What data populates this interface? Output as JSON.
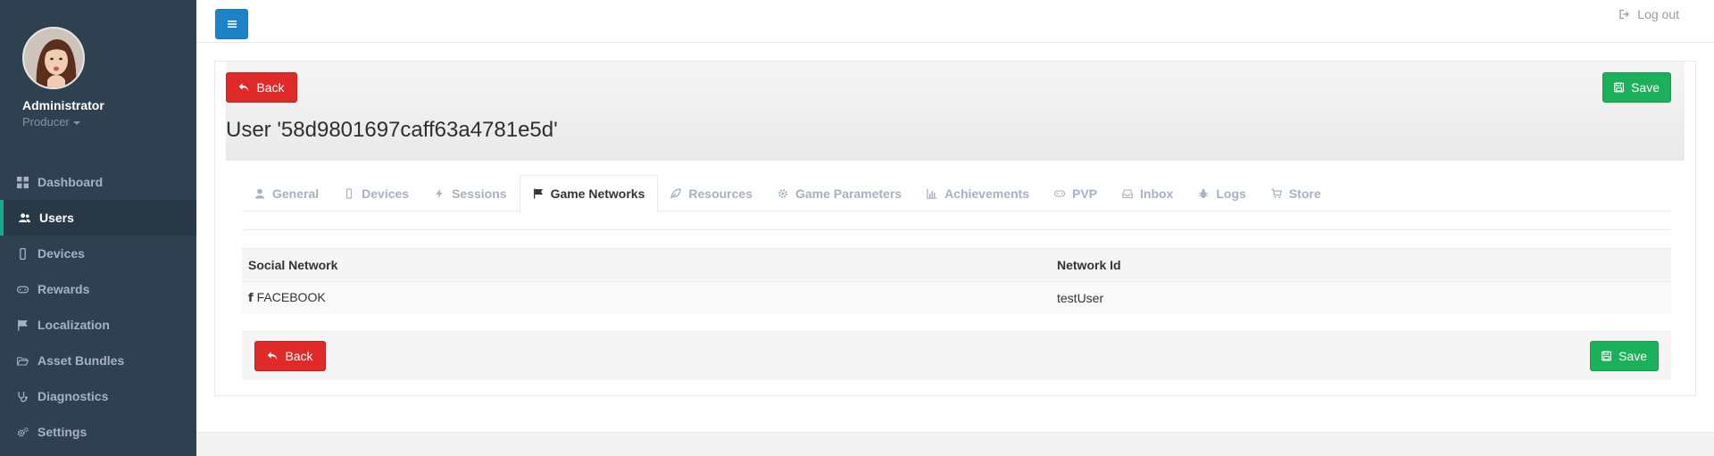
{
  "sidebar": {
    "profile": {
      "name": "Administrator",
      "role": "Producer"
    },
    "items": [
      {
        "label": "Dashboard",
        "icon": "dashboard-icon"
      },
      {
        "label": "Users",
        "icon": "users-icon",
        "active": true
      },
      {
        "label": "Devices",
        "icon": "mobile-icon"
      },
      {
        "label": "Rewards",
        "icon": "gamepad-icon"
      },
      {
        "label": "Localization",
        "icon": "flag-icon"
      },
      {
        "label": "Asset Bundles",
        "icon": "folder-open-icon"
      },
      {
        "label": "Diagnostics",
        "icon": "stethoscope-icon"
      },
      {
        "label": "Settings",
        "icon": "cogs-icon"
      }
    ]
  },
  "topbar": {
    "logout_label": "Log out"
  },
  "panel": {
    "title": "User '58d9801697caff63a4781e5d'",
    "back_label": "Back",
    "save_label": "Save"
  },
  "tabs": [
    {
      "label": "General",
      "icon": "user-icon"
    },
    {
      "label": "Devices",
      "icon": "mobile-icon"
    },
    {
      "label": "Sessions",
      "icon": "bolt-icon"
    },
    {
      "label": "Game Networks",
      "icon": "flag-icon",
      "active": true
    },
    {
      "label": "Resources",
      "icon": "leaf-icon"
    },
    {
      "label": "Game Parameters",
      "icon": "cog-icon"
    },
    {
      "label": "Achievements",
      "icon": "bar-chart-icon"
    },
    {
      "label": "PVP",
      "icon": "gamepad-icon"
    },
    {
      "label": "Inbox",
      "icon": "inbox-icon"
    },
    {
      "label": "Logs",
      "icon": "bug-icon"
    },
    {
      "label": "Store",
      "icon": "cart-icon"
    }
  ],
  "networks_table": {
    "headers": [
      "Social Network",
      "Network Id"
    ],
    "rows": [
      {
        "network": "FACEBOOK",
        "network_icon": "facebook-icon",
        "network_id": "testUser"
      }
    ]
  },
  "colors": {
    "sidebar_bg": "#2f4050",
    "active_accent": "#19aa8d",
    "back_button": "#e02a2a",
    "save_button": "#1ab15a",
    "menu_button": "#1c84c6"
  }
}
